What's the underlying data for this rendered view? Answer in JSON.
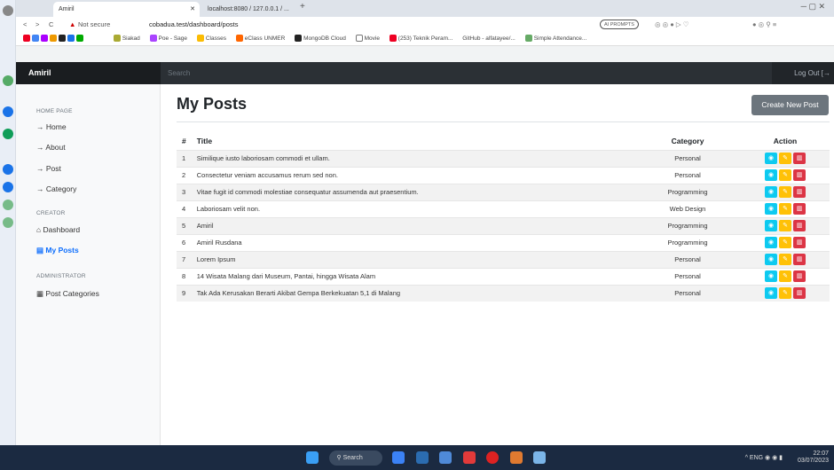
{
  "browser": {
    "tabs": [
      {
        "label": "Amiril",
        "active": true
      },
      {
        "label": "localhost:8080 / 127.0.0.1 / ...",
        "active": false
      }
    ],
    "security": "Not secure",
    "url": "cobadua.test/dashboard/posts",
    "ai_prompts": "AI PROMPTS",
    "bookmarks": [
      "Siakad",
      "Poe - Sage",
      "Classes",
      "eClass UNMER",
      "MongoDB Cloud",
      "Movie",
      "(253) Teknik Peram...",
      "GitHub - alfatayee/...",
      "Simple Attendance..."
    ]
  },
  "navbar": {
    "brand": "Amiril",
    "search_placeholder": "Search",
    "logout_label": "Log Out"
  },
  "sidebar": {
    "home_section": "HOME PAGE",
    "home_links": [
      "Home",
      "About",
      "Post",
      "Category"
    ],
    "creator_section": "CREATOR",
    "dashboard_label": "Dashboard",
    "myposts_label": "My Posts",
    "admin_section": "ADMINISTRATOR",
    "postcat_label": "Post Categories"
  },
  "main": {
    "title": "My Posts",
    "create_button": "Create New Post",
    "columns": {
      "num": "#",
      "title": "Title",
      "category": "Category",
      "action": "Action"
    },
    "posts": [
      {
        "num": "1",
        "title": "Similique iusto laboriosam commodi et ullam.",
        "category": "Personal"
      },
      {
        "num": "2",
        "title": "Consectetur veniam accusamus rerum sed non.",
        "category": "Personal"
      },
      {
        "num": "3",
        "title": "Vitae fugit id commodi molestiae consequatur assumenda aut praesentium.",
        "category": "Programming"
      },
      {
        "num": "4",
        "title": "Laboriosam velit non.",
        "category": "Web Design"
      },
      {
        "num": "5",
        "title": "Amiril",
        "category": "Programming"
      },
      {
        "num": "6",
        "title": "Amiril Rusdana",
        "category": "Programming"
      },
      {
        "num": "7",
        "title": "Lorem Ipsum",
        "category": "Personal"
      },
      {
        "num": "8",
        "title": "14 Wisata Malang dari Museum, Pantai, hingga Wisata Alam",
        "category": "Personal"
      },
      {
        "num": "9",
        "title": "Tak Ada Kerusakan Berarti Akibat Gempa Berkekuatan 5,1 di Malang",
        "category": "Personal"
      }
    ]
  },
  "taskbar": {
    "search_label": "Search",
    "lang": "ENG",
    "time": "22:07",
    "date": "03/07/2023"
  },
  "colors": {
    "view": "#0dcaf0",
    "edit": "#ffc107",
    "delete": "#dc3545",
    "navbar": "#212529",
    "accent": "#0d6efd"
  }
}
